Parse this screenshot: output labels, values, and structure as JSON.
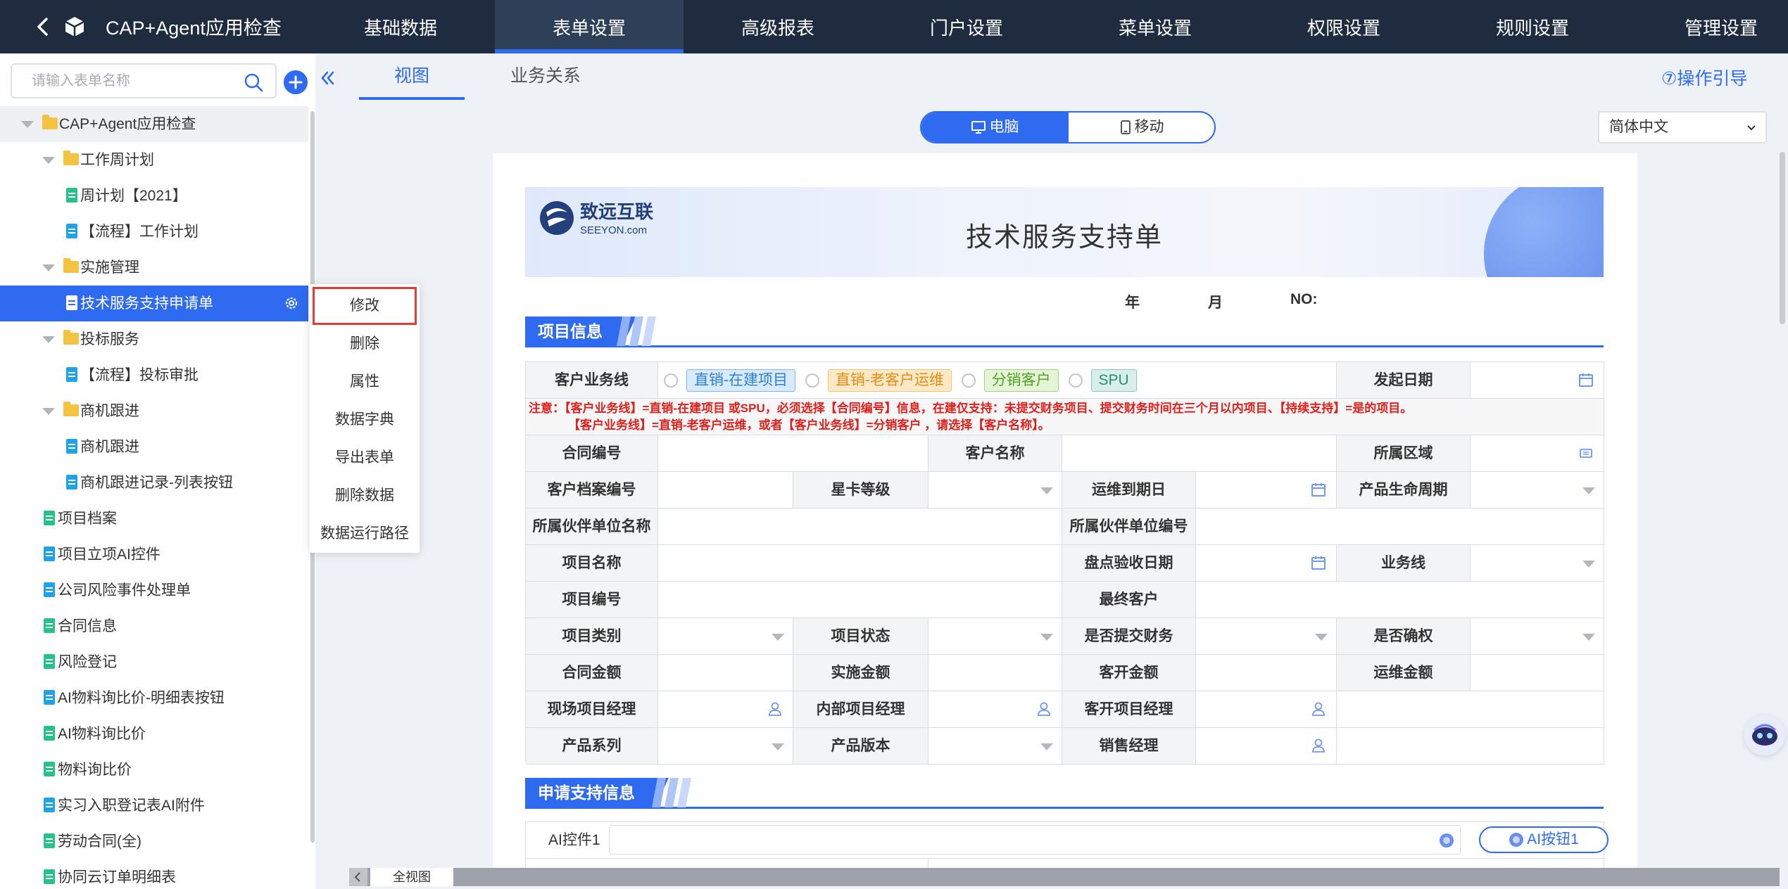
{
  "app": {
    "title": "CAP+Agent应用检查"
  },
  "top_nav": [
    {
      "label": "基础数据"
    },
    {
      "label": "表单设置"
    },
    {
      "label": "高级报表"
    },
    {
      "label": "门户设置"
    },
    {
      "label": "菜单设置"
    },
    {
      "label": "权限设置"
    },
    {
      "label": "规则设置"
    },
    {
      "label": "管理设置"
    }
  ],
  "active_nav": "表单设置",
  "sidebar": {
    "search_placeholder": "请输入表单名称",
    "items": [
      {
        "label": "CAP+Agent应用检查",
        "type": "folder",
        "level": 0,
        "expanded": true
      },
      {
        "label": "工作周计划",
        "type": "folder",
        "level": 1,
        "expanded": true
      },
      {
        "label": "周计划【2021】",
        "type": "doc",
        "color": "green",
        "level": 2
      },
      {
        "label": "【流程】工作计划",
        "type": "doc",
        "color": "blue",
        "level": 2
      },
      {
        "label": "实施管理",
        "type": "folder",
        "level": 1,
        "expanded": true
      },
      {
        "label": "技术服务支持申请单",
        "type": "doc",
        "color": "green",
        "level": 2,
        "selected": true
      },
      {
        "label": "投标服务",
        "type": "folder",
        "level": 1,
        "expanded": true
      },
      {
        "label": "【流程】投标审批",
        "type": "doc",
        "color": "blue",
        "level": 2
      },
      {
        "label": "商机跟进",
        "type": "folder",
        "level": 1,
        "expanded": true
      },
      {
        "label": "商机跟进",
        "type": "doc",
        "color": "blue",
        "level": 2
      },
      {
        "label": "商机跟进记录-列表按钮",
        "type": "doc",
        "color": "blue",
        "level": 2
      },
      {
        "label": "项目档案",
        "type": "doc",
        "color": "green",
        "level": 1
      },
      {
        "label": "项目立项AI控件",
        "type": "doc",
        "color": "blue",
        "level": 1
      },
      {
        "label": "公司风险事件处理单",
        "type": "doc",
        "color": "blue",
        "level": 1
      },
      {
        "label": "合同信息",
        "type": "doc",
        "color": "green",
        "level": 1
      },
      {
        "label": "风险登记",
        "type": "doc",
        "color": "green",
        "level": 1
      },
      {
        "label": "AI物料询比价-明细表按钮",
        "type": "doc",
        "color": "blue",
        "level": 1
      },
      {
        "label": "AI物料询比价",
        "type": "doc",
        "color": "green",
        "level": 1
      },
      {
        "label": "物料询比价",
        "type": "doc",
        "color": "green",
        "level": 1
      },
      {
        "label": "实习入职登记表AI附件",
        "type": "doc",
        "color": "blue",
        "level": 1
      },
      {
        "label": "劳动合同(全)",
        "type": "doc",
        "color": "green",
        "level": 1
      },
      {
        "label": "协同云订单明细表",
        "type": "doc",
        "color": "green",
        "level": 1
      }
    ]
  },
  "context_menu": [
    {
      "label": "修改",
      "highlighted": true
    },
    {
      "label": "删除"
    },
    {
      "label": "属性"
    },
    {
      "label": "数据字典"
    },
    {
      "label": "导出表单"
    },
    {
      "label": "删除数据"
    },
    {
      "label": "数据运行路径"
    }
  ],
  "tabs": [
    {
      "label": "视图",
      "active": true
    },
    {
      "label": "业务关系"
    }
  ],
  "guide_link": "⑦操作引导",
  "device_toggle": {
    "pc": "电脑",
    "mobile": "移动",
    "active": "pc"
  },
  "language": "简体中文",
  "form": {
    "title": "技术服务支持单",
    "logo_text": {
      "cn": "致远互联",
      "en": "SEEYON.com"
    },
    "date_labels": {
      "year": "年",
      "month": "月",
      "no": "NO:"
    },
    "section1": "项目信息",
    "section2": "申请支持信息",
    "biz_line_label": "客户业务线",
    "biz_line_options": [
      "直销-在建项目",
      "直销-老客户运维",
      "分销客户",
      "SPU"
    ],
    "start_date_label": "发起日期",
    "notice_line1": "注意：【客户业务线】=直销-在建项目 或SPU，必须选择【合同编号】信息，在建仅支持：未提交财务项目、提交财务时间在三个月以内项目、【持续支持】=是的项目。",
    "notice_line2": "【客户业务线】=直销-老客户运维，或者【客户业务线】=分销客户 ，请选择【客户名称】。",
    "labels": {
      "contract_no": "合同编号",
      "customer_name": "客户名称",
      "region": "所属区域",
      "customer_file_no": "客户档案编号",
      "star_level": "星卡等级",
      "ops_expire": "运维到期日",
      "product_lifecycle": "产品生命周期",
      "partner_name": "所属伙伴单位名称",
      "partner_no": "所属伙伴单位编号",
      "project_name": "项目名称",
      "inventory_date": "盘点验收日期",
      "business_line": "业务线",
      "project_no": "项目编号",
      "final_customer": "最终客户",
      "project_type": "项目类别",
      "project_status": "项目状态",
      "submitted_finance": "是否提交财务",
      "confirmed_right": "是否确权",
      "contract_amount": "合同金额",
      "impl_amount": "实施金额",
      "dev_amount": "客开金额",
      "ops_amount": "运维金额",
      "site_pm": "现场项目经理",
      "internal_pm": "内部项目经理",
      "dev_pm": "客开项目经理",
      "product_series": "产品系列",
      "product_version": "产品版本",
      "sales_manager": "销售经理"
    },
    "ai_control_label": "AI控件1",
    "ai_button_label": "AI按钮1"
  },
  "bottom_tab": "全视图"
}
